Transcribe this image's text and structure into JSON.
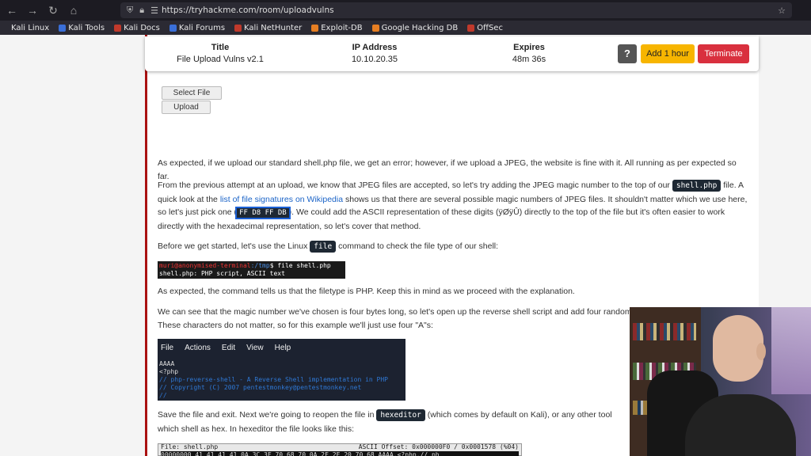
{
  "browser": {
    "url": "https://tryhackme.com/room/uploadvulns",
    "nav_back": "←",
    "nav_forward": "→",
    "nav_reload": "↻",
    "nav_home": "⌂",
    "bookmarks": [
      {
        "label": "Kali Linux",
        "color": "#2b2a33"
      },
      {
        "label": "Kali Tools",
        "color": "#3a6fd8"
      },
      {
        "label": "Kali Docs",
        "color": "#c0392b"
      },
      {
        "label": "Kali Forums",
        "color": "#3a6fd8"
      },
      {
        "label": "Kali NetHunter",
        "color": "#c0392b"
      },
      {
        "label": "Exploit-DB",
        "color": "#e67e22"
      },
      {
        "label": "Google Hacking DB",
        "color": "#e67e22"
      },
      {
        "label": "OffSec",
        "color": "#c0392b"
      }
    ]
  },
  "machine": {
    "title_header": "Title",
    "title_value": "File Upload Vulns v2.1",
    "ip_header": "IP Address",
    "ip_value": "10.10.20.35",
    "expires_header": "Expires",
    "expires_value": "48m 36s",
    "help_label": "?",
    "add_hour_label": "Add 1 hour",
    "terminate_label": "Terminate"
  },
  "upload": {
    "select_file_label": "Select File",
    "upload_label": "Upload"
  },
  "article": {
    "p1": "As expected, if we upload our standard shell.php file, we get an error; however, if we upload a JPEG, the website is fine with it. All running as per expected so far.",
    "p2_a": "From the previous attempt at an upload, we know that JPEG files are accepted, so let's try adding the JPEG magic number to the top of our",
    "p2_code1": "shell.php",
    "p2_b": "file. A quick look at the",
    "p2_link": "list of file signatures on Wikipedia",
    "p2_c": "shows us that there are several possible magic numbers of JPEG files. It shouldn't matter which we use here, so let's just pick one (",
    "p2_code2": "FF D8 FF DB",
    "p2_d": "). We could add the ASCII representation of these digits (ÿØÿÛ) directly to the top of the file but it's often easier to work directly with the hexadecimal representation, so let's cover that method.",
    "p3_a": "Before we get started, let's use the Linux",
    "p3_code": "file",
    "p3_b": "command to check the file type of our shell:",
    "term1_prompt_user": "muri@anonymised-terminal",
    "term1_prompt_path": ":/tmp",
    "term1_cmd": "$ file shell.php",
    "term1_out": "shell.php: PHP script, ASCII text",
    "p4": "As expected, the command tells us that the filetype is PHP. Keep this in mind as we proceed with the explanation.",
    "p5": "We can see that the magic number we've chosen is four bytes long, so let's open up the reverse shell script and add four random These characters do not matter, so for this example we'll just use four \"A\"s:",
    "editor_menu": [
      "File",
      "Actions",
      "Edit",
      "View",
      "Help"
    ],
    "editor_line1": "AAAA",
    "editor_line2": "<?php",
    "editor_line3": "// php-reverse-shell - A Reverse Shell implementation in PHP",
    "editor_line4": "// Copyright (C) 2007 pentestmonkey@pentestmonkey.net",
    "editor_line5": "//",
    "p6_a": "Save the file and exit. Next we're going to reopen the file in",
    "p6_code": "hexeditor",
    "p6_b": "(which comes by default on Kali), or any other tool which shell as hex. In hexeditor the file looks like this:",
    "hex_file": "File: shell.php",
    "hex_offset": "ASCII Offset: 0x000000F0 / 0x0001578 (%04)",
    "hex_row": "00000000  41 41 41 41  0A 3C 3F 70  68 70 0A 2F  2F 20 70 68    AAAA.<?php.// ph"
  }
}
